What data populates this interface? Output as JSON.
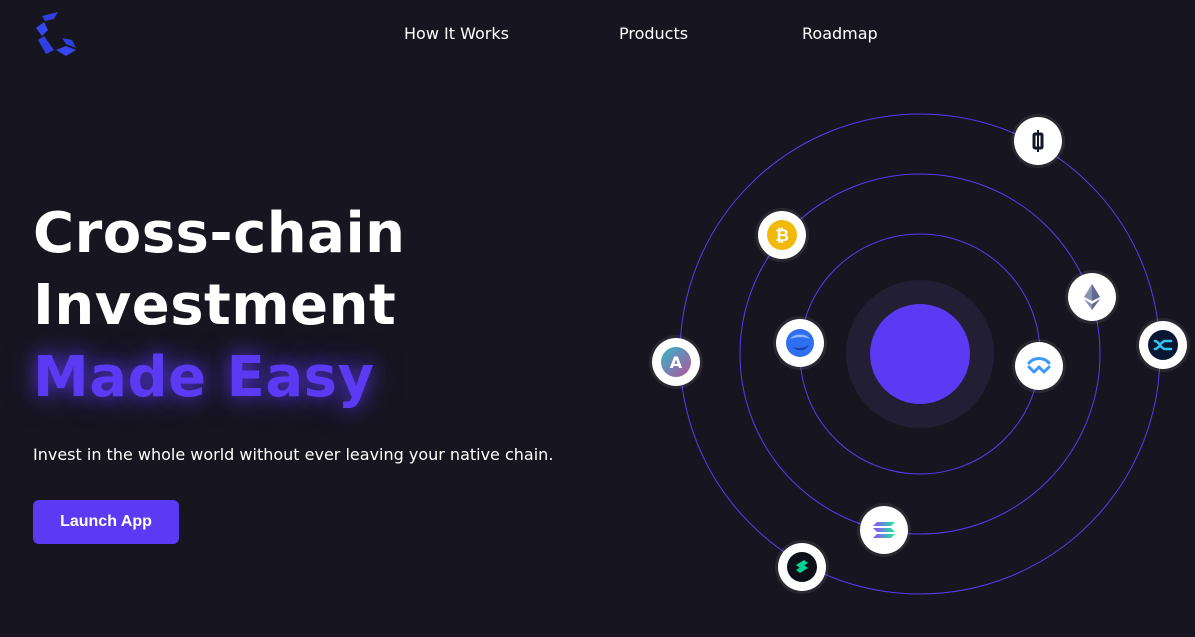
{
  "brand": {
    "logo_icon": "brand-logo-icon"
  },
  "nav": {
    "items": [
      {
        "label": "How It Works"
      },
      {
        "label": "Products"
      },
      {
        "label": "Roadmap"
      }
    ]
  },
  "hero": {
    "title_line1": "Cross-chain",
    "title_line2": "Investment",
    "title_accent": "Made Easy",
    "subtitle": "Invest in the whole world without ever leaving your native chain.",
    "cta_label": "Launch App"
  },
  "colors": {
    "background": "#17151f",
    "accent": "#5a3bf3",
    "orbit": "#5a3bf3",
    "text": "#ffffff"
  },
  "orbit_icons": [
    "candlestick-token-icon",
    "bitcoin-icon",
    "ethereum-icon",
    "sphere-token-icon",
    "walletconnect-icon",
    "aave-icon",
    "synapse-icon",
    "solana-icon",
    "compound-icon"
  ]
}
